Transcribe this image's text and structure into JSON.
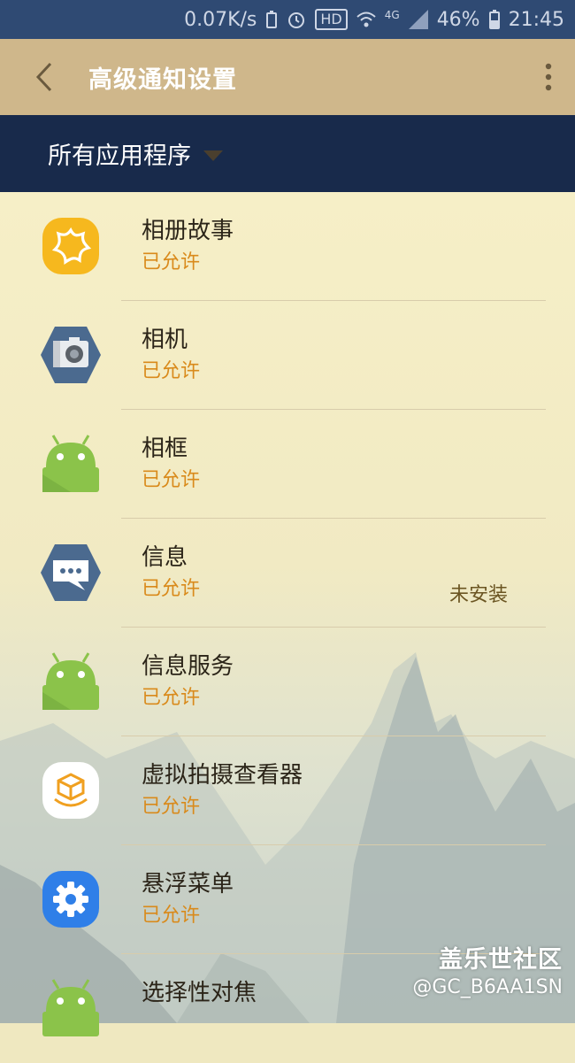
{
  "status_bar": {
    "net_speed": "0.07K/s",
    "hd": "HD",
    "network": "4G",
    "battery": "46%",
    "time": "21:45"
  },
  "toolbar": {
    "title": "高级通知设置"
  },
  "filter": {
    "label": "所有应用程序"
  },
  "apps": [
    {
      "name": "相册故事",
      "status": "已允许",
      "extra": "",
      "icon": "story-album-icon"
    },
    {
      "name": "相机",
      "status": "已允许",
      "extra": "",
      "icon": "camera-icon"
    },
    {
      "name": "相框",
      "status": "已允许",
      "extra": "",
      "icon": "android-icon"
    },
    {
      "name": "信息",
      "status": "已允许",
      "extra": "未安装",
      "icon": "messages-icon"
    },
    {
      "name": "信息服务",
      "status": "已允许",
      "extra": "",
      "icon": "android-icon"
    },
    {
      "name": "虚拟拍摄查看器",
      "status": "已允许",
      "extra": "",
      "icon": "virtual-shot-icon"
    },
    {
      "name": "悬浮菜单",
      "status": "已允许",
      "extra": "",
      "icon": "settings-gear-icon"
    },
    {
      "name": "选择性对焦",
      "status": "",
      "extra": "",
      "icon": "android-icon"
    }
  ],
  "watermark": {
    "line1": "盖乐世社区",
    "line2": "@GC_B6AA1SN"
  },
  "colors": {
    "status_bar": "#2f4a73",
    "toolbar": "#cfb78b",
    "filter_bar": "#182a4b",
    "status_text": "#d98a1b"
  }
}
